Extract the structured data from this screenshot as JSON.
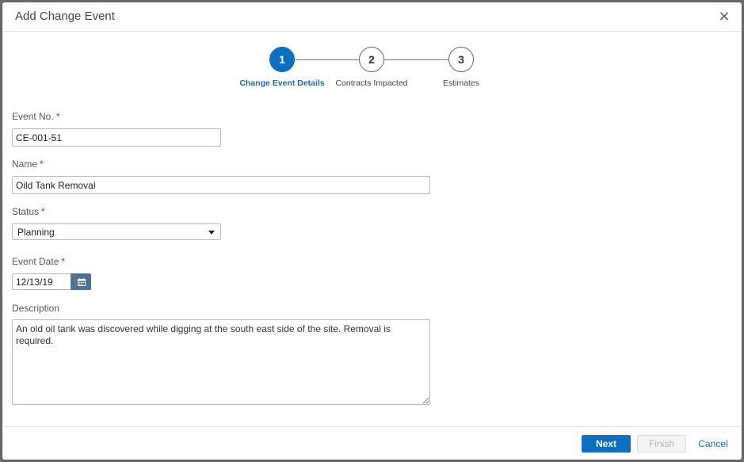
{
  "modal": {
    "title": "Add Change Event",
    "close_label": "×"
  },
  "stepper": {
    "steps": [
      {
        "number": "1",
        "label": "Change Event Details",
        "active": true
      },
      {
        "number": "2",
        "label": "Contracts Impacted",
        "active": false
      },
      {
        "number": "3",
        "label": "Estimates",
        "active": false
      }
    ]
  },
  "form": {
    "required_marker": "*",
    "event_no": {
      "label": "Event No.",
      "value": "CE-001-51"
    },
    "name": {
      "label": "Name",
      "value": "Oild Tank Removal"
    },
    "status": {
      "label": "Status",
      "value": "Planning"
    },
    "event_date": {
      "label": "Event Date",
      "value": "12/13/19"
    },
    "description": {
      "label": "Description",
      "value": "An old oil tank was discovered while digging at the south east side of the site. Removal is required."
    }
  },
  "footer": {
    "next_label": "Next",
    "finish_label": "Finish",
    "cancel_label": "Cancel"
  },
  "colors": {
    "accent": "#0d6fbf",
    "required": "#d9261c",
    "calendar_button": "#4f7396"
  }
}
